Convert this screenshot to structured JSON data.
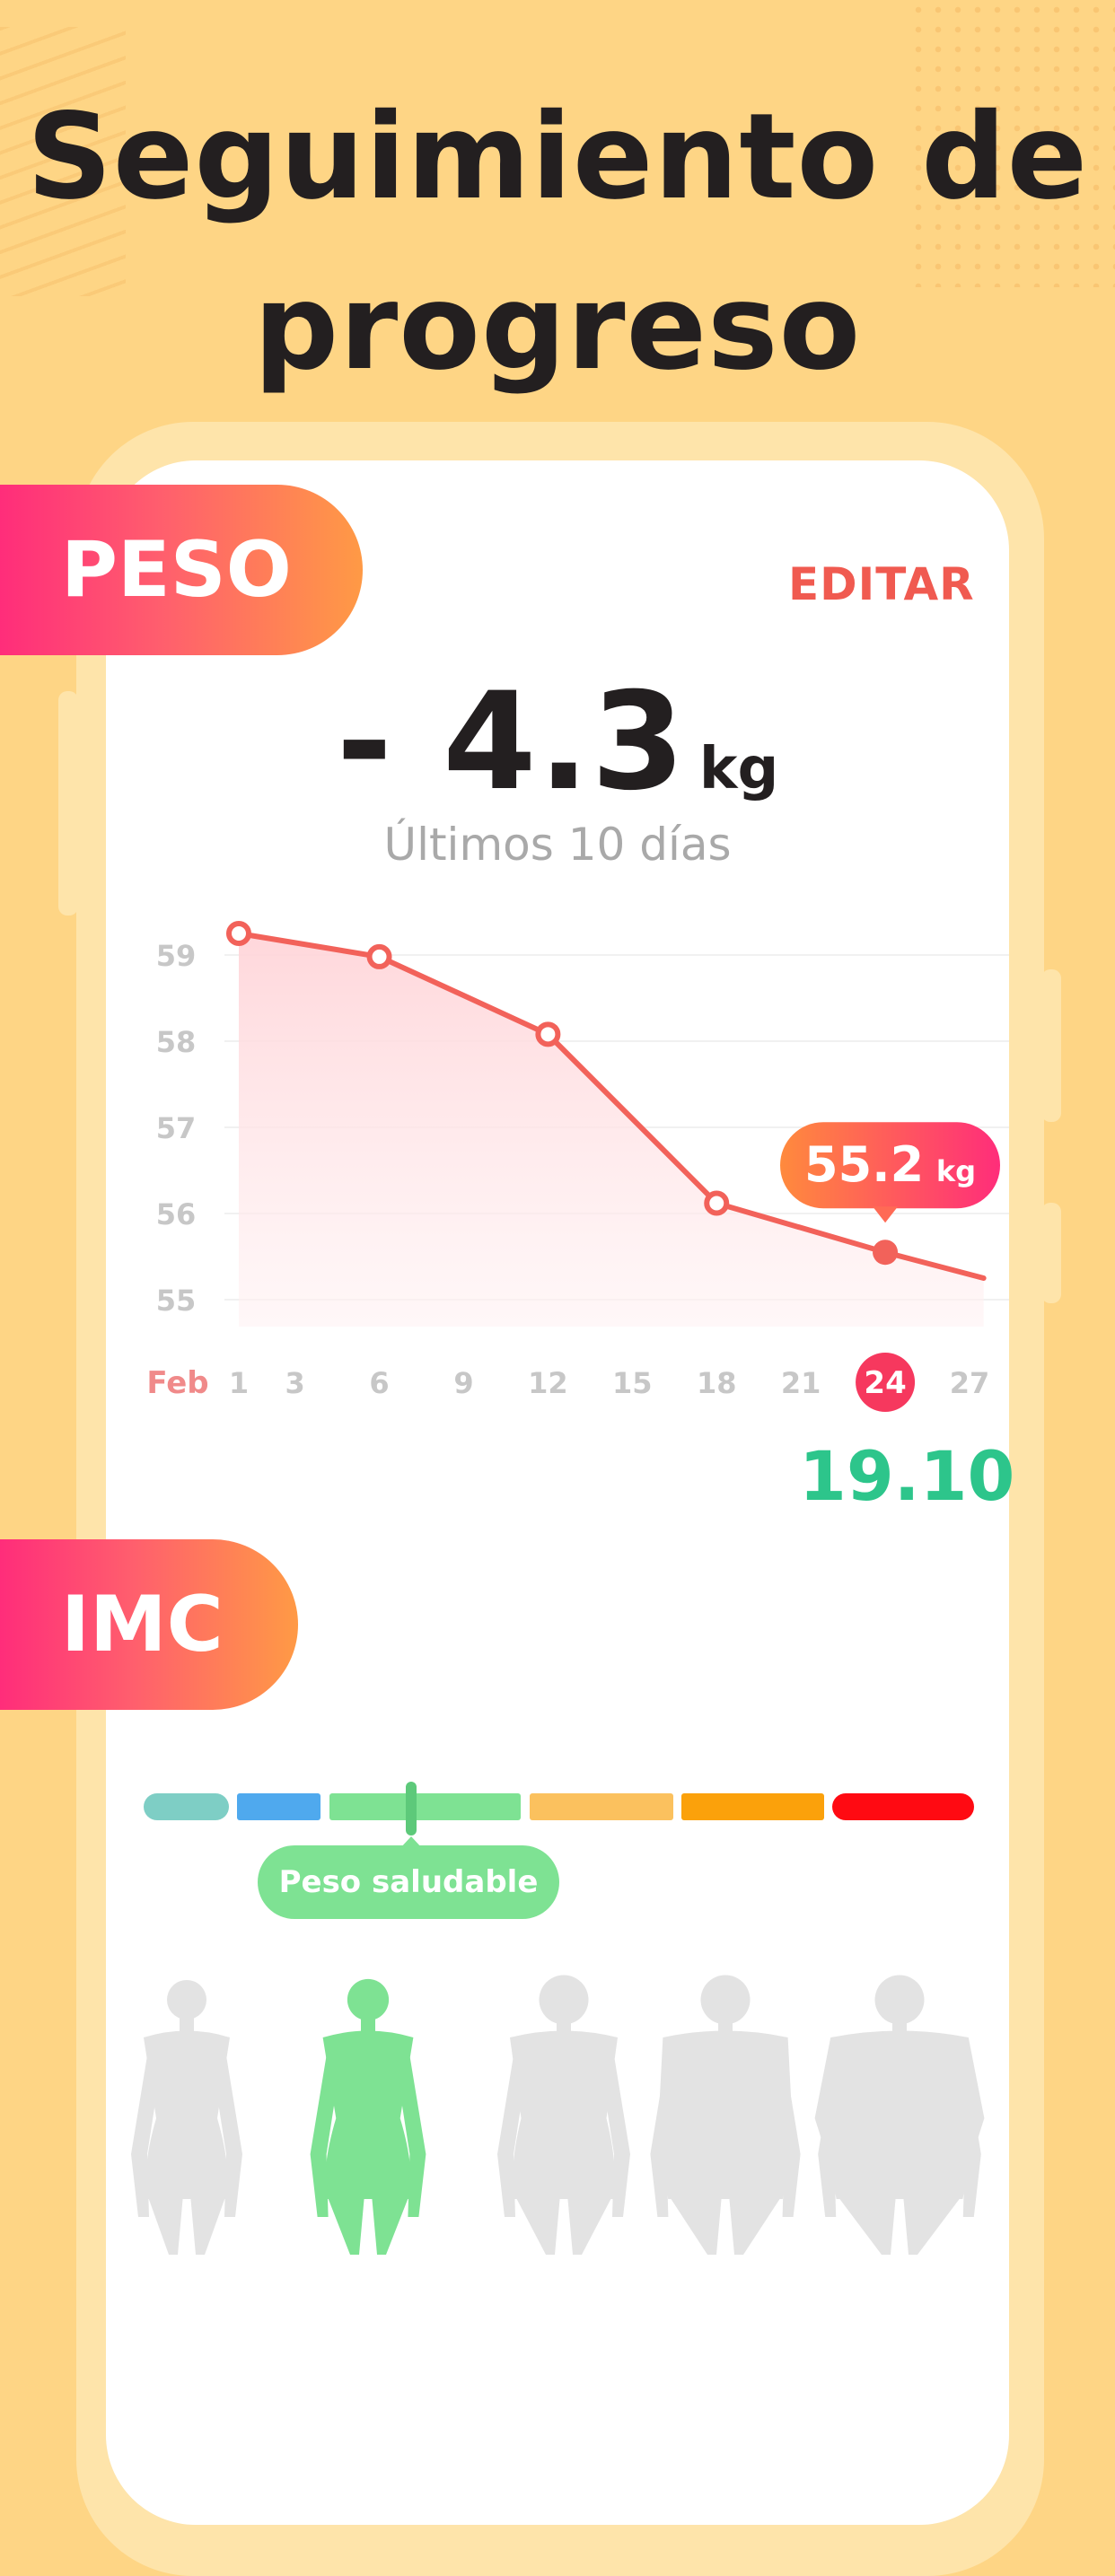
{
  "headline": {
    "line1": "Seguimiento de",
    "line2": "progreso"
  },
  "weight": {
    "tab_label": "PESO",
    "edit_label": "EDITAR",
    "change_value": "- 4.3",
    "change_unit": "kg",
    "subtitle": "Últimos 10 días",
    "tooltip_value": "55.2",
    "tooltip_unit": "kg"
  },
  "chart_data": {
    "type": "area",
    "x_label": "Feb",
    "x_ticks": [
      "1",
      "3",
      "6",
      "9",
      "12",
      "15",
      "18",
      "21",
      "24",
      "27"
    ],
    "y_ticks": [
      "59",
      "58",
      "57",
      "56",
      "55"
    ],
    "ylim": [
      55,
      59
    ],
    "points": [
      {
        "x": 1,
        "y": 59.25
      },
      {
        "x": 6,
        "y": 58.98
      },
      {
        "x": 12,
        "y": 58.08
      },
      {
        "x": 18,
        "y": 56.12
      },
      {
        "x": 24,
        "y": 55.55
      },
      {
        "x": 27.5,
        "y": 55.25
      }
    ],
    "selected_x": "24",
    "line_color": "#F2625A",
    "grid": true
  },
  "bmi": {
    "tab_label": "IMC",
    "value": "19.10",
    "status_label": "Peso saludable",
    "scale_colors": [
      "#7ECEC5",
      "#4FA9EE",
      "#7EE293",
      "#FBC15E",
      "#FBA10B",
      "#FF0A12"
    ],
    "active_figure_color": "#7EE293",
    "inactive_figure_color": "#E3E3E3",
    "value_color": "#2DC58B"
  }
}
